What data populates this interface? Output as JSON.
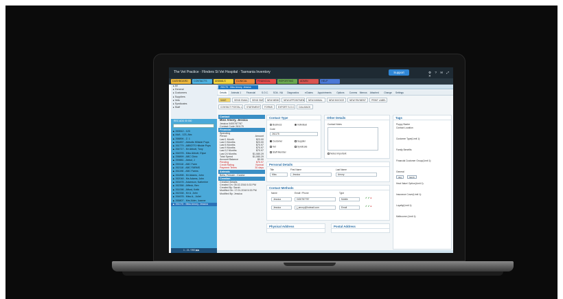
{
  "app": {
    "title": "The Vet Practice · Flinders St Vet Hospital · Tasmania Inventory",
    "support_label": "Support",
    "title_icons": "⚙ ? ✉ ⤢ ✕"
  },
  "menubar": [
    {
      "label": "DASHBOARD",
      "color": "#f0b93c"
    },
    {
      "label": "CONTACTS",
      "color": "#4fb3e2"
    },
    {
      "label": "ANIMALS",
      "color": "#f4d23b"
    },
    {
      "label": "CLINICAL",
      "color": "#f08a3a"
    },
    {
      "label": "FINANCIAL",
      "color": "#e84a4a"
    },
    {
      "label": "REPORTING",
      "color": "#6aa84f"
    },
    {
      "label": "ADMIN",
      "color": "#d9534f"
    },
    {
      "label": "HELP",
      "color": "#4a78d6"
    }
  ],
  "sidebar": {
    "tree": [
      "All",
      "General",
      "Customers",
      "Suppliers",
      "Vets",
      "Syndicates",
      "Staff"
    ],
    "list_header": "REC ADD 00 000",
    "records": [
      "263512 - 123",
      "AAA - 123, Abc",
      "268894 - Z. 1",
      "261837 - Abbotts Hillside Pups",
      "261779 - ABBOTS Hillside Pups",
      "264717 - Mr Abbott, Tony",
      "264978 - Miss Abbott, Elyse",
      "258899 - ABC Clinic",
      "259881 - Abbot, J",
      "259118 - ABC Farm",
      "262118 - ABC FARMS",
      "261198 - ABC Farms",
      "261898 - Mr Adams, John",
      "262048 - Ms Adams, John",
      "263478 - Adamson, Katherine",
      "262358 - Affleck, Ben",
      "261098 - Afford, Keith",
      "262338 - Mr A. John",
      "264678 - Miss A., Juliet",
      "265807 - Mrs Alder, Joanne",
      "261175 - Miss Amory, Jessica"
    ],
    "selected_index": 20,
    "footer": "1 - 21 / 990  ▶▶"
  },
  "record": {
    "tab_label": "261175 - Miss Amory, Jessica",
    "subtabs": [
      "Details",
      "Animals 1",
      "Financial",
      "S.O.C.",
      "SOA - NA",
      "Diagnostics",
      "eClaims",
      "Appointments",
      "Options",
      "Comms",
      "Memos",
      "Attached",
      "Change",
      "Settings"
    ],
    "toolbar": [
      {
        "label": "SAVE"
      },
      {
        "label": "SEND EMAIL"
      },
      {
        "label": "SEND SMS"
      },
      {
        "label": "NEW MEMO"
      },
      {
        "label": "NEW APPOINTMENT"
      },
      {
        "label": "NEW ANIMAL"
      },
      {
        "label": "NEW INVOICE"
      },
      {
        "label": "NEW PAYMENT"
      },
      {
        "label": "PRINT LABEL"
      },
      {
        "label": "CONTACT POSTAL LABEL"
      },
      {
        "label": "STATEMENT"
      },
      {
        "label": "FORMS"
      },
      {
        "label": "EXPORT S.O.C."
      },
      {
        "label": "CALLBACK"
      }
    ]
  },
  "summary": {
    "contact_header": "Contact",
    "name": "Miss Amory, Jessica",
    "lines": [
      "Jessica  0400787787",
      "Contact Code  261175"
    ],
    "financial_header": "Financial",
    "spending_label": "Spending",
    "period_label": "Period",
    "amount_label": "Amount",
    "rows": [
      {
        "k": "Last 1 Month",
        "v": "$23.00"
      },
      {
        "k": "Last 3 Months",
        "v": "$23.00"
      },
      {
        "k": "Last 6 Months",
        "v": "$70.97"
      },
      {
        "k": "Last 9 Months",
        "v": "$70.97"
      },
      {
        "k": "Last 12 Months",
        "v": "$70.97"
      },
      {
        "k": "Last 24 Months",
        "v": "$1,080.29"
      },
      {
        "k": "Total Spend",
        "v": "$1,080.29"
      },
      {
        "k": "Account Balance",
        "v": "$0.00"
      }
    ],
    "red_rows": [
      {
        "k": "Pending",
        "v": "$70.97"
      },
      {
        "k": "Credit Rating",
        "v": "Normal"
      },
      {
        "k": "Payment Terms",
        "v": "30 days"
      }
    ],
    "animals_header": "Animals",
    "animals": [
      "Bella, Female - Canine"
    ],
    "creation_header": "Creation",
    "creation_lines": [
      "Creation Details",
      "Created On: 05.02.2016 5:33 PM",
      "Created By: Sarah",
      "Modified On: 17.01.2018 5:33 PM",
      "Modified By: Jessica"
    ]
  },
  "contact_type": {
    "header": "Contact Type",
    "options": [
      "Business",
      "Individual"
    ],
    "code_label": "Code",
    "code_value": "261175",
    "checks": [
      "Customer",
      "Supplier",
      "Vet",
      "Syndicate",
      "Staff Member"
    ]
  },
  "other_details": {
    "header": "Other Details",
    "contact_notes_label": "Contact Notes",
    "notes_important_label": "Notes Important"
  },
  "personal": {
    "header": "Personal Details",
    "title_label": "Title",
    "title_value": "Miss",
    "first_label": "First Name",
    "first_value": "Jessica",
    "last_label": "Last Name",
    "last_value": "Amory"
  },
  "methods": {
    "header": "Contact Methods",
    "cols": [
      "Name",
      "Email / Phone",
      "Type"
    ],
    "rows": [
      {
        "name": "Jessica",
        "value": "0400787787",
        "type": "Mobile"
      },
      {
        "name": "Jessica",
        "value": "j_amory@hotmail.com",
        "type": "Email"
      }
    ]
  },
  "address": {
    "physical": "Physical Address",
    "postal": "Postal Address"
  },
  "tags": {
    "header": "Tags",
    "groups": [
      "Puppy Starter",
      "Contact Location",
      "Customer Type(Limit 1):",
      "Family Benefits",
      "Financial Customer Group(Limit 1):",
      "General",
      "Heat Value/ Option(Limit 1):",
      "Insurance Cover(Limit 1):",
      "Loyalty(Limit 1):",
      "Melbourne (Limit 1):"
    ],
    "general_tags": [
      "dog",
      "harsh"
    ]
  }
}
